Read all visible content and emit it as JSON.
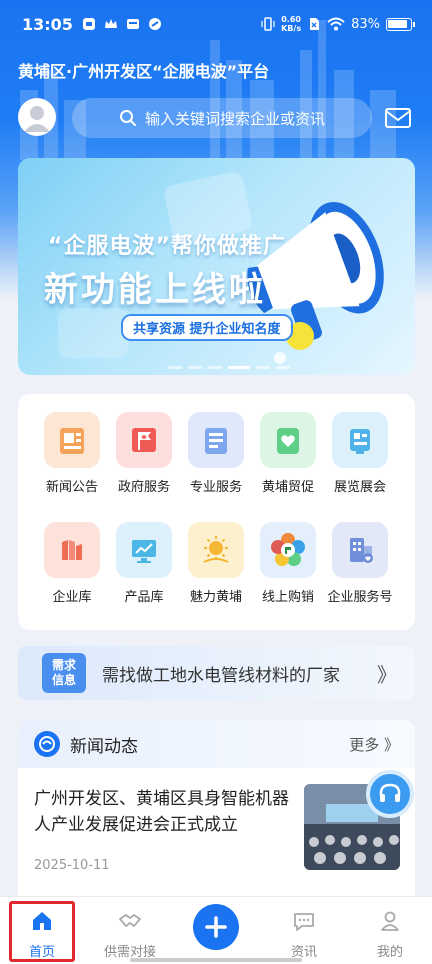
{
  "status_bar": {
    "time": "13:05",
    "net_speed_value": "0.60",
    "net_speed_unit": "KB/s",
    "battery": "83%"
  },
  "header": {
    "platform_title": "黄埔区·广州开发区“企服电波”平台",
    "search_placeholder": "输入关键词搜索企业或资讯"
  },
  "banner": {
    "line1": "“企服电波”帮你做推广",
    "line2": "新功能上线啦",
    "tag": "共享资源 提升企业知名度"
  },
  "grid": [
    {
      "label": "新闻公告",
      "icon": "news-icon",
      "color": "#f5a25a"
    },
    {
      "label": "政府服务",
      "icon": "flag-icon",
      "color": "#ef5a55"
    },
    {
      "label": "专业服务",
      "icon": "document-icon",
      "color": "#7da6ef"
    },
    {
      "label": "黄埔贸促",
      "icon": "heart-shield-icon",
      "color": "#5fcf87"
    },
    {
      "label": "展览展会",
      "icon": "exhibition-icon",
      "color": "#4fb3ea"
    },
    {
      "label": "企业库",
      "icon": "library-icon",
      "color": "#ef6d55"
    },
    {
      "label": "产品库",
      "icon": "monitor-icon",
      "color": "#4ab7e6"
    },
    {
      "label": "魅力黄埔",
      "icon": "sun-icon",
      "color": "#f5b631"
    },
    {
      "label": "线上购销",
      "icon": "flower-logo-icon",
      "color": "#3aa0e8"
    },
    {
      "label": "企业服务号",
      "icon": "building-icon",
      "color": "#6f8fd9"
    }
  ],
  "demand": {
    "badge_line1": "需求",
    "badge_line2": "信息",
    "text": "需找做工地水电管线材料的厂家"
  },
  "news": {
    "section_title": "新闻动态",
    "more_label": "更多",
    "item_title": "广州开发区、黄埔区具身智能机器人产业发展促进会正式成立",
    "item_date": "2025-10-11"
  },
  "tabbar": {
    "home": "首页",
    "supply": "供需对接",
    "info": "资讯",
    "mine": "我的"
  }
}
